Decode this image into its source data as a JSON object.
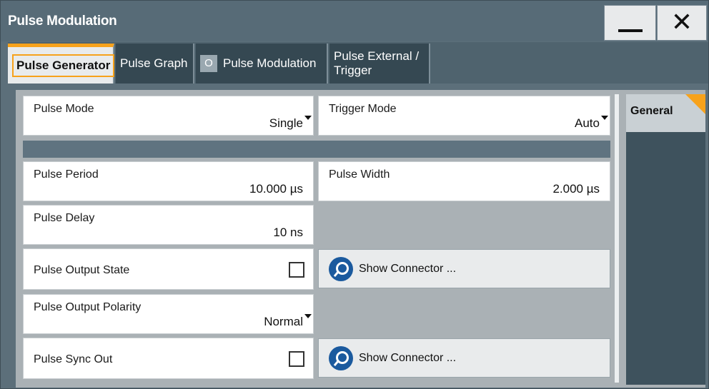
{
  "window": {
    "title": "Pulse Modulation",
    "minimize_icon": "minimize-icon",
    "close_icon": "close-icon"
  },
  "tabs": [
    {
      "label": "Pulse Generator",
      "active": true
    },
    {
      "label": "Pulse Graph",
      "active": false
    },
    {
      "label": "Pulse Modulation",
      "active": false,
      "state_indicator": "O"
    },
    {
      "label": "Pulse External / Trigger",
      "active": false
    }
  ],
  "fields": {
    "pulse_mode": {
      "label": "Pulse Mode",
      "value": "Single"
    },
    "trigger_mode": {
      "label": "Trigger Mode",
      "value": "Auto"
    },
    "pulse_period": {
      "label": "Pulse Period",
      "value": "10.000 µs"
    },
    "pulse_width": {
      "label": "Pulse Width",
      "value": "2.000 µs"
    },
    "pulse_delay": {
      "label": "Pulse Delay",
      "value": "10 ns"
    },
    "pulse_output_state": {
      "label": "Pulse Output State",
      "checked": false
    },
    "pulse_output_polarity": {
      "label": "Pulse Output Polarity",
      "value": "Normal"
    },
    "pulse_sync_out": {
      "label": "Pulse Sync Out",
      "checked": false
    }
  },
  "buttons": {
    "show_connector_1": "Show Connector ...",
    "show_connector_2": "Show Connector ..."
  },
  "side_tab": {
    "label": "General"
  },
  "colors": {
    "accent": "#f7a21b",
    "titlebar": "#576b77",
    "panel": "#aab1b5",
    "icon_blue": "#1b5a9e"
  }
}
